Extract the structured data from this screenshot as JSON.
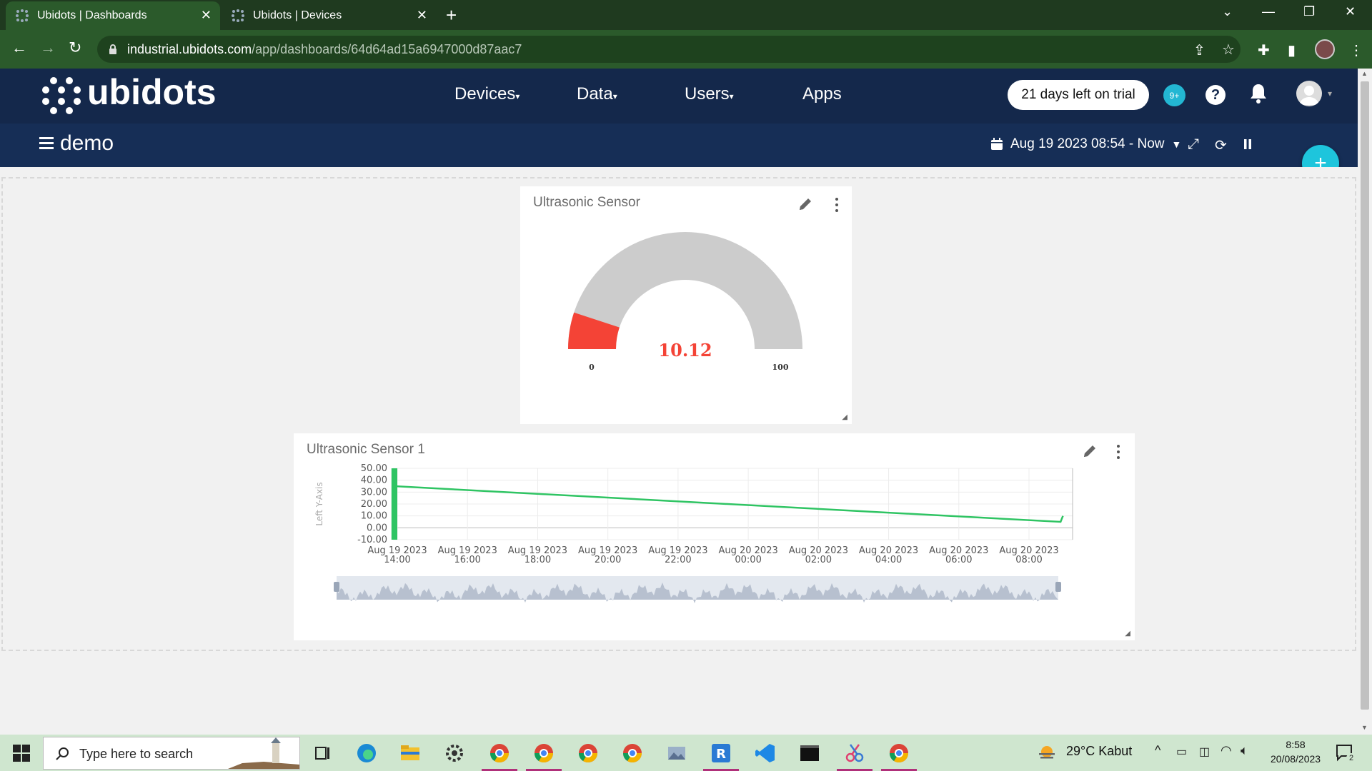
{
  "browser": {
    "tabs": [
      {
        "title": "Ubidots | Dashboards",
        "active": true
      },
      {
        "title": "Ubidots | Devices",
        "active": false
      }
    ],
    "url_host": "industrial.ubidots.com",
    "url_path": "/app/dashboards/64d64ad15a6947000d87aac7"
  },
  "header": {
    "logo_text": "ubidots",
    "nav": [
      {
        "label": "Devices",
        "has_caret": true
      },
      {
        "label": "Data",
        "has_caret": true
      },
      {
        "label": "Users",
        "has_caret": true
      },
      {
        "label": "Apps",
        "has_caret": false
      }
    ],
    "trial_label": "21 days left on trial",
    "notif_badge": "9+",
    "help_label": "?"
  },
  "dashboard": {
    "name": "demo",
    "date_range": "Aug 19 2023 08:54 - Now",
    "add_label": "+"
  },
  "widgets": {
    "gauge": {
      "title": "Ultrasonic Sensor",
      "value": "10.12",
      "min_label": "0",
      "max_label": "100",
      "fill_fraction": 0.1012,
      "fill_color": "#f44336",
      "track_color": "#cccccc"
    },
    "linechart": {
      "title": "Ultrasonic Sensor 1",
      "line_color": "#2fc463"
    }
  },
  "chart_data": {
    "type": "line",
    "title": "Ultrasonic Sensor 1",
    "ylabel": "Left Y-Axis",
    "ylim": [
      -10,
      50
    ],
    "yticks": [
      "50.00",
      "40.00",
      "30.00",
      "20.00",
      "10.00",
      "0.00",
      "-10.00"
    ],
    "xticks": [
      {
        "date": "Aug 19 2023",
        "time": "14:00"
      },
      {
        "date": "Aug 19 2023",
        "time": "16:00"
      },
      {
        "date": "Aug 19 2023",
        "time": "18:00"
      },
      {
        "date": "Aug 19 2023",
        "time": "20:00"
      },
      {
        "date": "Aug 19 2023",
        "time": "22:00"
      },
      {
        "date": "Aug 20 2023",
        "time": "00:00"
      },
      {
        "date": "Aug 20 2023",
        "time": "02:00"
      },
      {
        "date": "Aug 20 2023",
        "time": "04:00"
      },
      {
        "date": "Aug 20 2023",
        "time": "06:00"
      },
      {
        "date": "Aug 20 2023",
        "time": "08:00"
      }
    ],
    "series": [
      {
        "points": [
          {
            "x": "2023-08-19 13:55",
            "y": 35
          },
          {
            "x": "2023-08-20 08:54",
            "y": 5
          },
          {
            "x": "2023-08-20 08:58",
            "y": 10
          }
        ],
        "dense_band": {
          "x_from": "2023-08-19 13:50",
          "x_to": "2023-08-19 14:00",
          "y_from": -10,
          "y_to": 50
        }
      }
    ],
    "grid": true
  },
  "taskbar": {
    "search_placeholder": "Type here to search",
    "weather": "29°C  Kabut",
    "time": "8:58",
    "date": "20/08/2023",
    "notif_count": "2"
  }
}
